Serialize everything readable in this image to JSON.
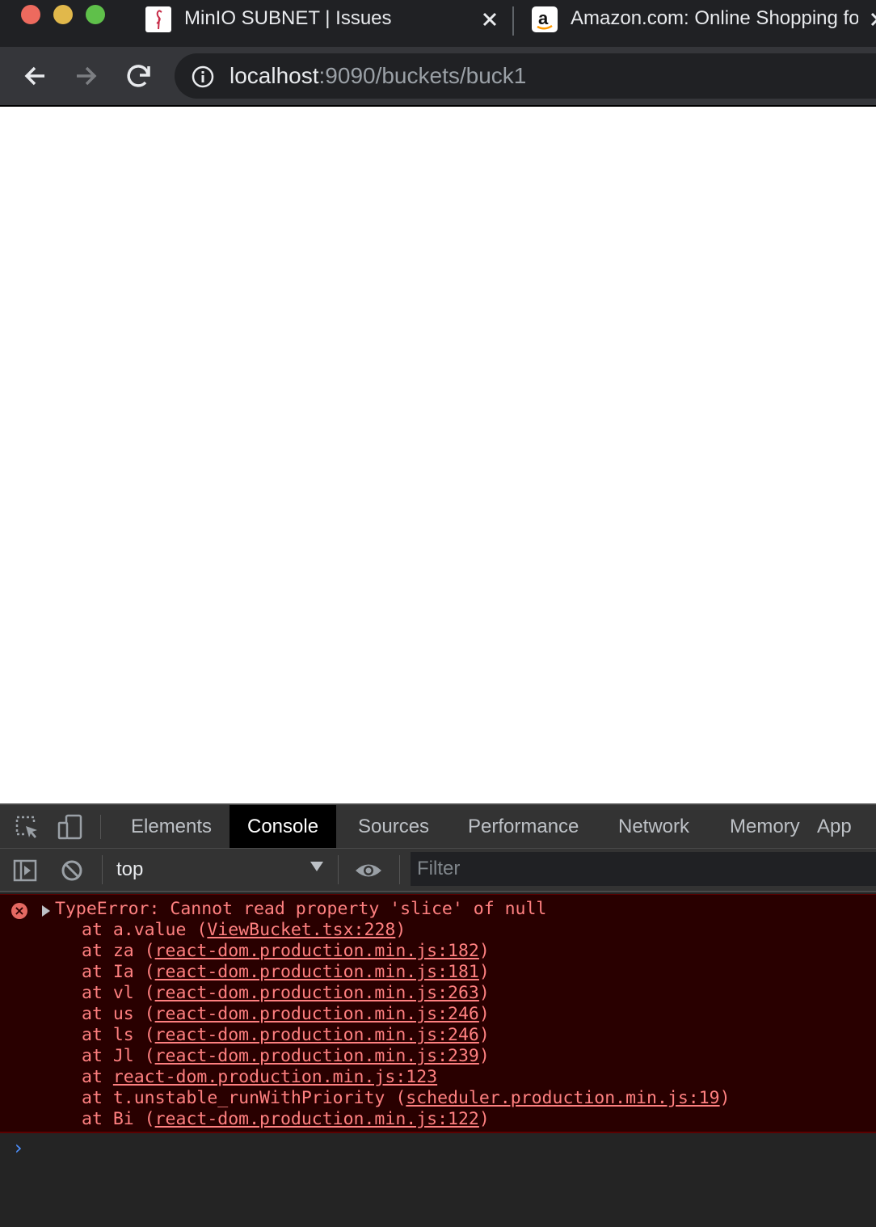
{
  "browser": {
    "tabs": [
      {
        "title": "MinIO SUBNET | Issues",
        "active": true,
        "favicon": "minio-flamingo-icon"
      },
      {
        "title": "Amazon.com: Online Shopping for",
        "active": false,
        "favicon": "amazon-a-icon"
      }
    ],
    "url": {
      "host": "localhost",
      "rest": ":9090/buckets/buck1"
    }
  },
  "devtools": {
    "tabs": [
      "Elements",
      "Console",
      "Sources",
      "Performance",
      "Network",
      "Memory",
      "App"
    ],
    "active_tab": "Console",
    "console": {
      "context": "top",
      "filter_placeholder": "Filter",
      "error": {
        "message": "TypeError: Cannot read property 'slice' of null",
        "stack": [
          {
            "prefix": "at a.value (",
            "link": "ViewBucket.tsx:228",
            "suffix": ")"
          },
          {
            "prefix": "at za (",
            "link": "react-dom.production.min.js:182",
            "suffix": ")"
          },
          {
            "prefix": "at Ia (",
            "link": "react-dom.production.min.js:181",
            "suffix": ")"
          },
          {
            "prefix": "at vl (",
            "link": "react-dom.production.min.js:263",
            "suffix": ")"
          },
          {
            "prefix": "at us (",
            "link": "react-dom.production.min.js:246",
            "suffix": ")"
          },
          {
            "prefix": "at ls (",
            "link": "react-dom.production.min.js:246",
            "suffix": ")"
          },
          {
            "prefix": "at Jl (",
            "link": "react-dom.production.min.js:239",
            "suffix": ")"
          },
          {
            "prefix": "at ",
            "link": "react-dom.production.min.js:123",
            "suffix": ""
          },
          {
            "prefix": "at t.unstable_runWithPriority (",
            "link": "scheduler.production.min.js:19",
            "suffix": ")"
          },
          {
            "prefix": "at Bi (",
            "link": "react-dom.production.min.js:122",
            "suffix": ")"
          }
        ]
      },
      "prompt": "›"
    }
  },
  "colors": {
    "error_bg": "#290000",
    "error_text": "#ff8080",
    "prompt": "#4d90fe"
  }
}
